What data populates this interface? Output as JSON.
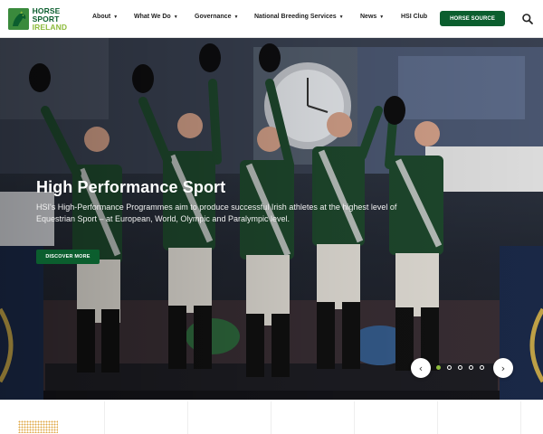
{
  "brand": {
    "line1": "HORSE SPORT",
    "line2": "IRELAND",
    "green": "#0b5e2e",
    "lime": "#8dbb3c"
  },
  "nav": {
    "items": [
      {
        "label": "About",
        "has_dropdown": true
      },
      {
        "label": "What We Do",
        "has_dropdown": true
      },
      {
        "label": "Governance",
        "has_dropdown": true
      },
      {
        "label": "National Breeding Services",
        "has_dropdown": true
      },
      {
        "label": "News",
        "has_dropdown": true
      },
      {
        "label": "HSI Club",
        "has_dropdown": false
      }
    ],
    "cta_label": "HORSE SOURCE",
    "search_icon": "search-icon"
  },
  "hero": {
    "title": "High Performance Sport",
    "text": "HSI's High-Performance Programmes aim to produce successful Irish athletes at the highest level of Equestrian Sport – at European, World, Olympic and Paralympic level.",
    "button_label": "DISCOVER MORE",
    "prev_icon": "chevron-left-icon",
    "next_icon": "chevron-right-icon",
    "slide_count": 5,
    "active_slide": 1
  }
}
